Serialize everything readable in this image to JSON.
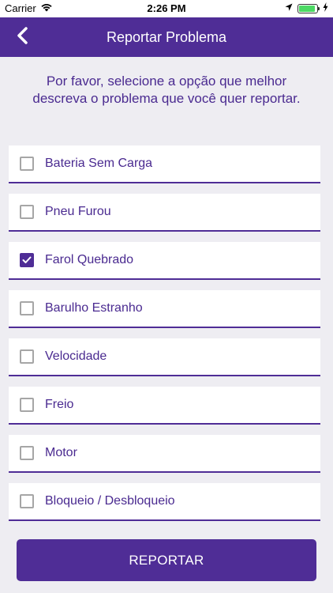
{
  "status_bar": {
    "carrier": "Carrier",
    "time": "2:26 PM",
    "battery_level": 0.9
  },
  "header": {
    "title": "Reportar Problema",
    "back_icon": "chevron-left-icon"
  },
  "prompt": "Por favor, selecione a opção que melhor descreva o problema que você quer reportar.",
  "options": [
    {
      "label": "Bateria Sem Carga",
      "checked": false
    },
    {
      "label": "Pneu Furou",
      "checked": false
    },
    {
      "label": "Farol Quebrado",
      "checked": true
    },
    {
      "label": "Barulho Estranho",
      "checked": false
    },
    {
      "label": "Velocidade",
      "checked": false
    },
    {
      "label": "Freio",
      "checked": false
    },
    {
      "label": "Motor",
      "checked": false
    },
    {
      "label": "Bloqueio / Desbloqueio",
      "checked": false
    }
  ],
  "submit_label": "REPORTAR",
  "colors": {
    "primary": "#4f2d96",
    "text_primary": "#4a2a90",
    "background": "#eeedf2",
    "battery": "#4cd964"
  }
}
